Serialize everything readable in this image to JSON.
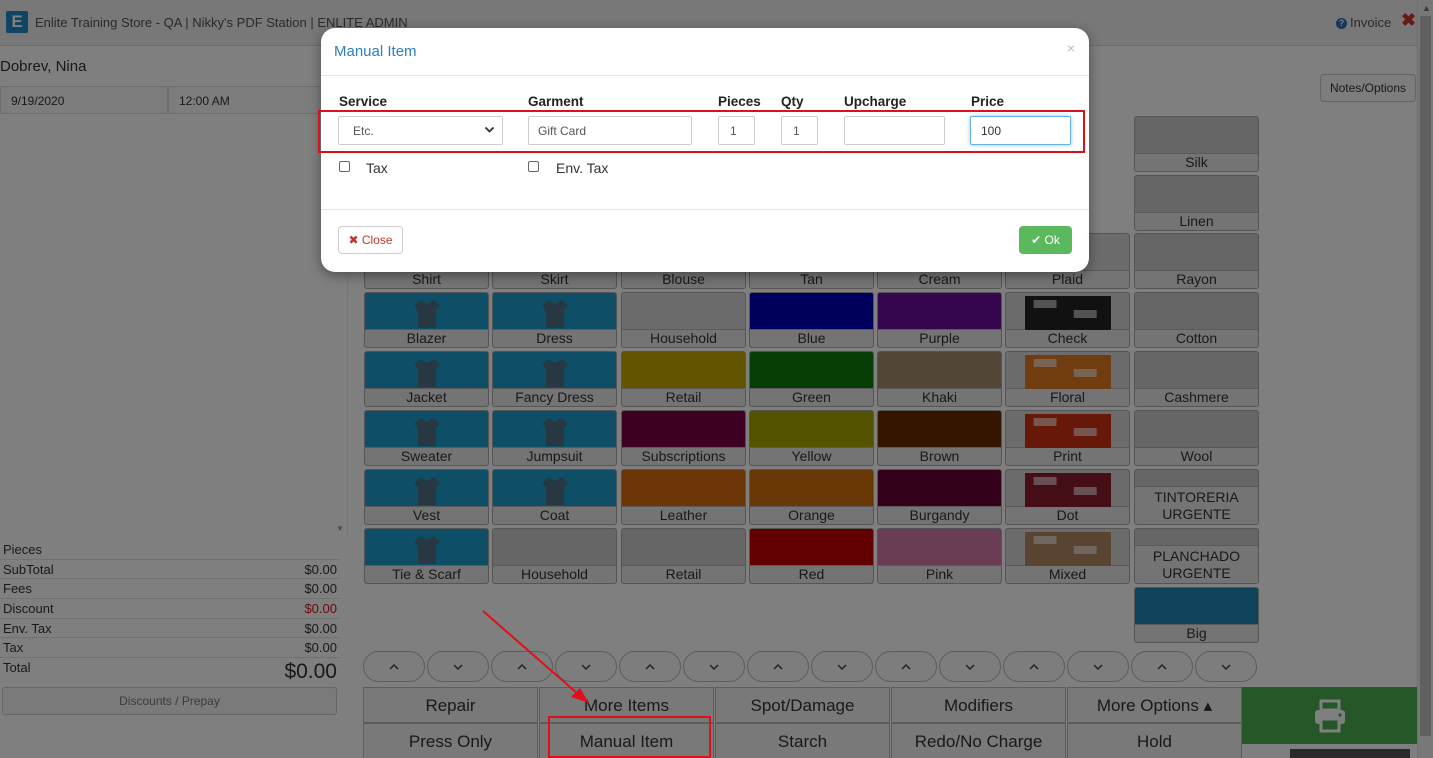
{
  "header": {
    "logo_letter": "E",
    "title": "Enlite Training Store - QA | Nikky's PDF Station | ENLITE ADMIN",
    "invoice_label": "Invoice",
    "close_glyph": "✖"
  },
  "customer": {
    "name": "Dobrev, Nina",
    "date": "9/19/2020",
    "time": "12:00 AM"
  },
  "totals": [
    {
      "label": "Pieces",
      "value": ""
    },
    {
      "label": "SubTotal",
      "value": "$0.00"
    },
    {
      "label": "Fees",
      "value": "$0.00"
    },
    {
      "label": "Discount",
      "value": "$0.00"
    },
    {
      "label": "Env. Tax",
      "value": "$0.00"
    },
    {
      "label": "Tax",
      "value": "$0.00"
    },
    {
      "label": "Total",
      "value": "$0.00"
    }
  ],
  "discounts_button": "Discounts / Prepay",
  "notes_button": "Notes/Options",
  "tiles": {
    "row1": [
      "Shirt",
      "Skirt",
      "Blouse",
      "Tan",
      "Cream",
      "Plaid",
      "Rayon"
    ],
    "row2": [
      "Blazer",
      "Dress",
      "Household",
      "Blue",
      "Purple",
      "Check",
      "Cotton"
    ],
    "row3": [
      "Jacket",
      "Fancy Dress",
      "Retail",
      "Green",
      "Khaki",
      "Floral",
      "Cashmere"
    ],
    "row4": [
      "Sweater",
      "Jumpsuit",
      "Subscriptions",
      "Yellow",
      "Brown",
      "Print",
      "Wool"
    ],
    "row5": [
      "Vest",
      "Coat",
      "Leather",
      "Orange",
      "Burgandy",
      "Dot",
      "TINTORERIA URGENTE"
    ],
    "row6": [
      "Tie & Scarf",
      "Household",
      "Retail",
      "Red",
      "Pink",
      "Mixed",
      "PLANCHADO URGENTE"
    ],
    "extra": [
      "Silk",
      "Linen",
      "Big"
    ]
  },
  "tile_colors": {
    "garment_blue": "#1d9ccc",
    "blue": "#0000b8",
    "purple": "#6a0a9a",
    "green": "#0a7a0a",
    "khaki": "#a38d6b",
    "yellow": "#a8a800",
    "brown": "#6b2a00",
    "orange": "#d4700a",
    "burgandy": "#6a0032",
    "red": "#c40000",
    "pink": "#d47aa8",
    "retail": "#c7a800",
    "subscriptions": "#7a0040",
    "leather": "#d86c12",
    "big": "#1e88b7"
  },
  "arrows": {
    "up": "^",
    "down": "v"
  },
  "bottom_buttons": {
    "row1": [
      "Repair",
      "More Items",
      "Spot/Damage",
      "Modifiers",
      "More Options ▴"
    ],
    "row2": [
      "Press Only",
      "Manual Item",
      "Starch",
      "Redo/No Charge",
      "Hold"
    ]
  },
  "print_icon": "printer-icon",
  "modal": {
    "title": "Manual Item",
    "close_x": "×",
    "headers": {
      "service": "Service",
      "garment": "Garment",
      "pieces": "Pieces",
      "qty": "Qty",
      "upcharge": "Upcharge",
      "price": "Price"
    },
    "values": {
      "service": "Etc.",
      "garment": "Gift Card",
      "pieces": "1",
      "qty": "1",
      "upcharge": "",
      "price": "100"
    },
    "tax_label": "Tax",
    "env_tax_label": "Env. Tax",
    "close_button": "✖ Close",
    "ok_button": "✔ Ok"
  },
  "colors": {
    "accent_blue": "#2e7fc2",
    "highlight_red": "#e0101a",
    "ok_green": "#5cb85c",
    "print_green": "#4caf50"
  }
}
